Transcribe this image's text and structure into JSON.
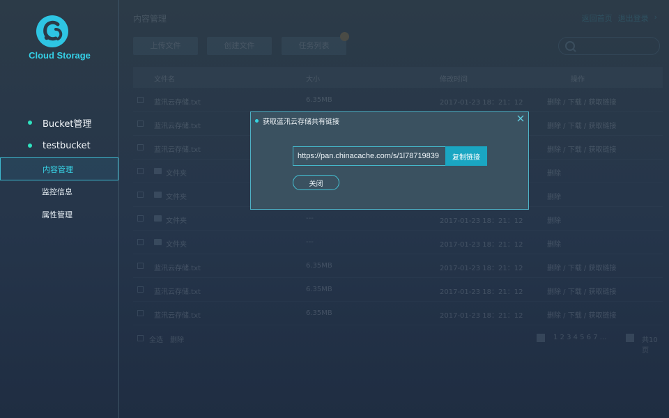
{
  "brand": {
    "name": "Cloud Storage"
  },
  "sidebar": {
    "buckets": [
      {
        "label": "Bucket管理"
      },
      {
        "label": "testbucket"
      }
    ],
    "items": [
      {
        "label": "内容管理",
        "active": true
      },
      {
        "label": "监控信息"
      },
      {
        "label": "属性管理"
      }
    ]
  },
  "main": {
    "title": "内容管理",
    "top_links": [
      "返回首页",
      "退出登录"
    ],
    "toolbar": [
      "上传文件",
      "创建文件",
      "任务列表"
    ],
    "table": {
      "headers": [
        "文件名",
        "大小",
        "修改时间",
        "操作"
      ],
      "rows": [
        {
          "type": "file",
          "name": "蓝汛云存储.txt",
          "size": "6.35MB",
          "time": "2017-01-23 18：21：12",
          "actions": "删除 / 下载 / 获取链接"
        },
        {
          "type": "file",
          "name": "蓝汛云存储.txt",
          "size": "6.35MB",
          "time": "2017-01-23 18：21：12",
          "actions": "删除 / 下载 / 获取链接"
        },
        {
          "type": "file",
          "name": "蓝汛云存储.txt",
          "size": "6.35MB",
          "time": "2017-01-23 18：21：12",
          "actions": "删除 / 下载 / 获取链接"
        },
        {
          "type": "folder",
          "name": "文件夹",
          "size": "---",
          "time": "2017-01-23 18：21：12",
          "actions": "删除"
        },
        {
          "type": "folder",
          "name": "文件夹",
          "size": "---",
          "time": "2017-01-23 18：21：12",
          "actions": "删除"
        },
        {
          "type": "folder",
          "name": "文件夹",
          "size": "---",
          "time": "2017-01-23 18：21：12",
          "actions": "删除"
        },
        {
          "type": "folder",
          "name": "文件夹",
          "size": "---",
          "time": "2017-01-23 18：21：12",
          "actions": "删除"
        },
        {
          "type": "file",
          "name": "蓝汛云存储.txt",
          "size": "6.35MB",
          "time": "2017-01-23 18：21：12",
          "actions": "删除 / 下载 / 获取链接"
        },
        {
          "type": "file",
          "name": "蓝汛云存储.txt",
          "size": "6.35MB",
          "time": "2017-01-23 18：21：12",
          "actions": "删除 / 下载 / 获取链接"
        },
        {
          "type": "file",
          "name": "蓝汛云存储.txt",
          "size": "6.35MB",
          "time": "2017-01-23 18：21：12",
          "actions": "删除 / 下载 / 获取链接"
        }
      ]
    },
    "footer": {
      "select_all": "全选",
      "delete": "删除",
      "pages": "1 2 3 4 5 6 7 ...",
      "total": "共10页"
    }
  },
  "modal": {
    "title": "获取蓝汛云存储共有链接",
    "link": "https://pan.chinacache.com/s/1l78719839",
    "copy_label": "复制链接",
    "close_label": "关闭"
  },
  "colors": {
    "accent": "#35d0e6",
    "highlight": "#2fe3c0",
    "button": "#1aa6c2"
  },
  "icons": {
    "logo": "cloud-c-logo-icon",
    "search": "search-icon",
    "close": "close-icon",
    "folder": "folder-icon"
  }
}
